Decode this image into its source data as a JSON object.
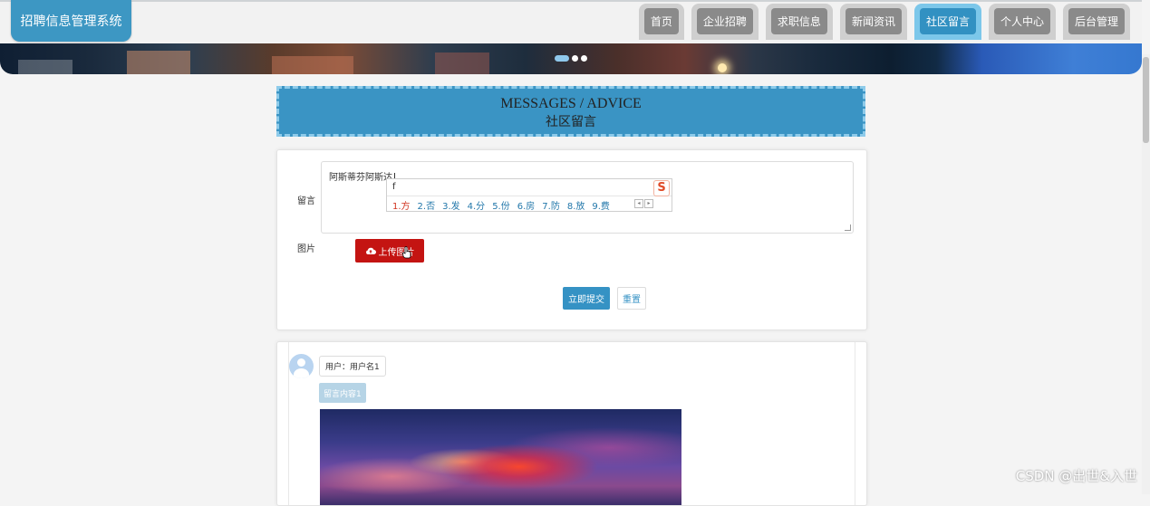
{
  "app": {
    "title": "招聘信息管理系统"
  },
  "nav": {
    "items": [
      {
        "label": "首页",
        "active": false
      },
      {
        "label": "企业招聘",
        "active": false
      },
      {
        "label": "求职信息",
        "active": false
      },
      {
        "label": "新闻资讯",
        "active": false
      },
      {
        "label": "社区留言",
        "active": true
      },
      {
        "label": "个人中心",
        "active": false
      },
      {
        "label": "后台管理",
        "active": false
      }
    ]
  },
  "banner": {
    "slide_count": 3,
    "active_slide": 1
  },
  "section": {
    "title_en": "MESSAGES / ADVICE",
    "title_cn": "社区留言"
  },
  "form": {
    "message_label": "留言",
    "message_value": "阿斯蒂芬阿斯达",
    "image_label": "图片",
    "upload_label": "上传图片",
    "submit_label": "立即提交",
    "reset_label": "重置"
  },
  "ime": {
    "input": "f",
    "logo": "S",
    "candidates": [
      "1.方",
      "2.否",
      "3.发",
      "4.分",
      "5.份",
      "6.房",
      "7.防",
      "8.放",
      "9.费"
    ]
  },
  "messages": [
    {
      "user": "用户：用户名1",
      "content": "留言内容1"
    }
  ],
  "colors": {
    "primary": "#3592c4",
    "upload": "#c41412",
    "nav_tab": "#8a8a8a",
    "nav_active": "#3291c2"
  },
  "watermark": "CSDN @出世&入世"
}
